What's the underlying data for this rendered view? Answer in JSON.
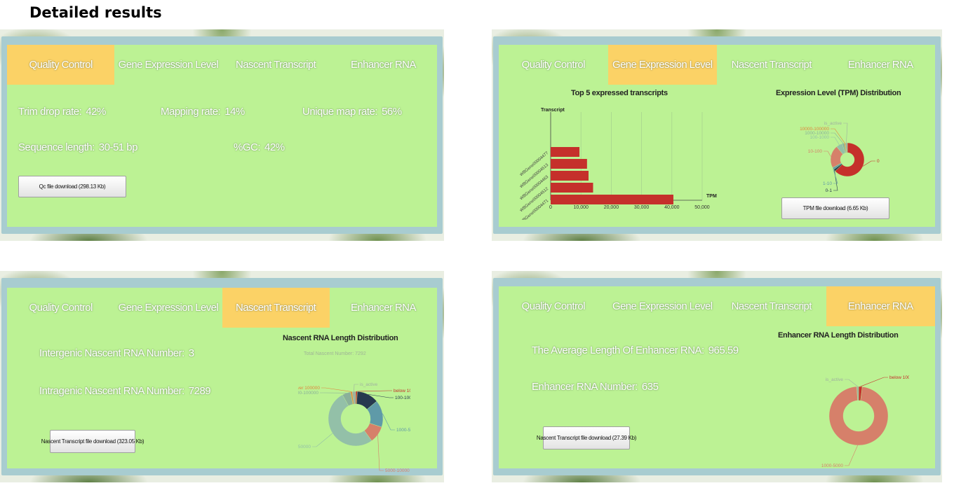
{
  "page_title": "Detailed results",
  "tabs": [
    "Quality Control",
    "Gene Expression Level",
    "Nascent Transcript",
    "Enhancer RNA"
  ],
  "qc": {
    "trim_drop_label": "Trim drop rate:",
    "trim_drop_value": "42%",
    "mapping_label": "Mapping rate:",
    "mapping_value": "14%",
    "unique_label": "Unique map rate:",
    "unique_value": "56%",
    "seqlen_label": "Sequence length:",
    "seqlen_value": "30-51 bp",
    "gc_label": "%GC:",
    "gc_value": "42%",
    "download_label": "Qc file download (298.13 Kb)"
  },
  "gene": {
    "bar_title": "Top 5 expressed transcripts",
    "bar_ylabel": "Transcript",
    "bar_xlabel": "TPM",
    "donut_title": "Expression Level (TPM) Distribution",
    "download_label": "TPM file download (6.65 Kb)"
  },
  "nascent": {
    "intergenic_label": "Intergenic Nascent RNA Number:",
    "intergenic_value": "3",
    "intragenic_label": "Intragenic Nascent RNA Number:",
    "intragenic_value": "7289",
    "chart_title": "Nascent RNA Length Distribution",
    "chart_subtitle": "Total Nascent Number: 7292",
    "download_label": "Nascent Transcript file download (323.05 Kb)"
  },
  "enhancer": {
    "avg_label": "The Average Length Of Enhancer RNA:",
    "avg_value": "965.59",
    "number_label": "Enhancer RNA Number:",
    "number_value": "635",
    "chart_title": "Enhancer RNA Length Distribution",
    "download_label": "Nascent Transcript file download (27.39 Kb)"
  },
  "colors": {
    "panel_bg": "#bcf294",
    "active_tab": "#fbd266",
    "bar": "#c5302b",
    "donut_red": "#c5302b",
    "donut_navy": "#27394f",
    "donut_teal": "#5f9aa8",
    "donut_sage": "#93c0a8",
    "donut_salmon": "#d6806a",
    "donut_orange": "#e0853c"
  },
  "chart_data": [
    {
      "type": "bar",
      "orientation": "horizontal",
      "title": "Top 5 expressed transcripts",
      "ylabel": "Transcript",
      "xlabel": "TPM",
      "categories": [
        "WBGene00004477",
        "WBGene00004513",
        "WBGene00004463",
        "WBGene00004512",
        "WBGene00004471"
      ],
      "values": [
        9500,
        12000,
        12500,
        14000,
        40500
      ],
      "xlim": [
        0,
        50000
      ],
      "xticks": [
        "0",
        "10,000",
        "20,000",
        "30,000",
        "40,000",
        "50,000"
      ],
      "grid": true
    },
    {
      "type": "pie",
      "donut": true,
      "title": "Expression Level (TPM) Distribution",
      "categories": [
        "0",
        "0-1",
        "1-10",
        "10-100",
        "100-1000",
        "1000-10000",
        "10000-100000",
        "is_active"
      ],
      "values": [
        63,
        2,
        2,
        22,
        6,
        2,
        1,
        2
      ],
      "colors": [
        "#c5302b",
        "#27394f",
        "#5f9aa8",
        "#d6806a",
        "#93c0a8",
        "#8ab09a",
        "#e0853c",
        "#9fb0a0"
      ]
    },
    {
      "type": "pie",
      "donut": true,
      "title": "Nascent RNA Length Distribution",
      "subtitle": "Total Nascent Number: 7292",
      "categories": [
        "below 100",
        "100-1000",
        "1000-5000",
        "5000-10000",
        "10000-50000",
        "50000-100000",
        "over 100000",
        "is_active"
      ],
      "values": [
        1,
        13,
        16,
        10,
        52,
        5,
        1,
        2
      ],
      "colors": [
        "#c5302b",
        "#27394f",
        "#5f9aa8",
        "#d6806a",
        "#93c0a8",
        "#8ab09a",
        "#e0853c",
        "#9fb0a0"
      ]
    },
    {
      "type": "pie",
      "donut": true,
      "title": "Enhancer RNA Length Distribution",
      "categories": [
        "below 100",
        "1000-5000",
        "is_active"
      ],
      "values": [
        2,
        97,
        1
      ],
      "colors": [
        "#c5302b",
        "#d6806a",
        "#9fb0a0"
      ]
    }
  ]
}
